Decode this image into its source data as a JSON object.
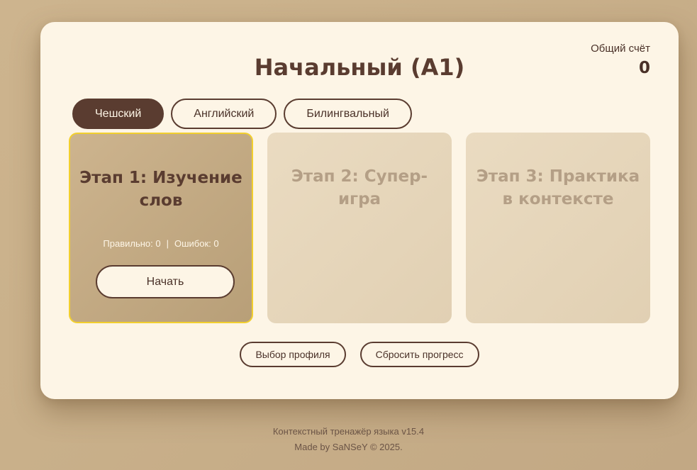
{
  "header": {
    "title": "Начальный (A1)",
    "score_label": "Общий счёт",
    "score_value": "0"
  },
  "tabs": [
    {
      "label": "Чешский",
      "active": true
    },
    {
      "label": "Английский",
      "active": false
    },
    {
      "label": "Билингвальный",
      "active": false
    }
  ],
  "stages": [
    {
      "title": "Этап 1: Изучение слов",
      "stats": {
        "correct_label": "Правильно: 0",
        "separator": "|",
        "errors_label": "Ошибок: 0"
      },
      "start_label": "Начать",
      "active": true
    },
    {
      "title": "Этап 2: Супер-игра",
      "active": false
    },
    {
      "title": "Этап 3: Практика в контексте",
      "active": false
    }
  ],
  "actions": {
    "profile_label": "Выбор профиля",
    "reset_label": "Сбросить прогресс"
  },
  "footer": {
    "line1": "Контекстный тренажёр языка v15.4",
    "line2": "Made by SaNSeY © 2025."
  },
  "colors": {
    "background": "#c9b08a",
    "card": "#fdf5e6",
    "primary": "#5a3c30",
    "highlight_border": "#f2cf2e",
    "inactive_stage": "#e6d6bb"
  }
}
